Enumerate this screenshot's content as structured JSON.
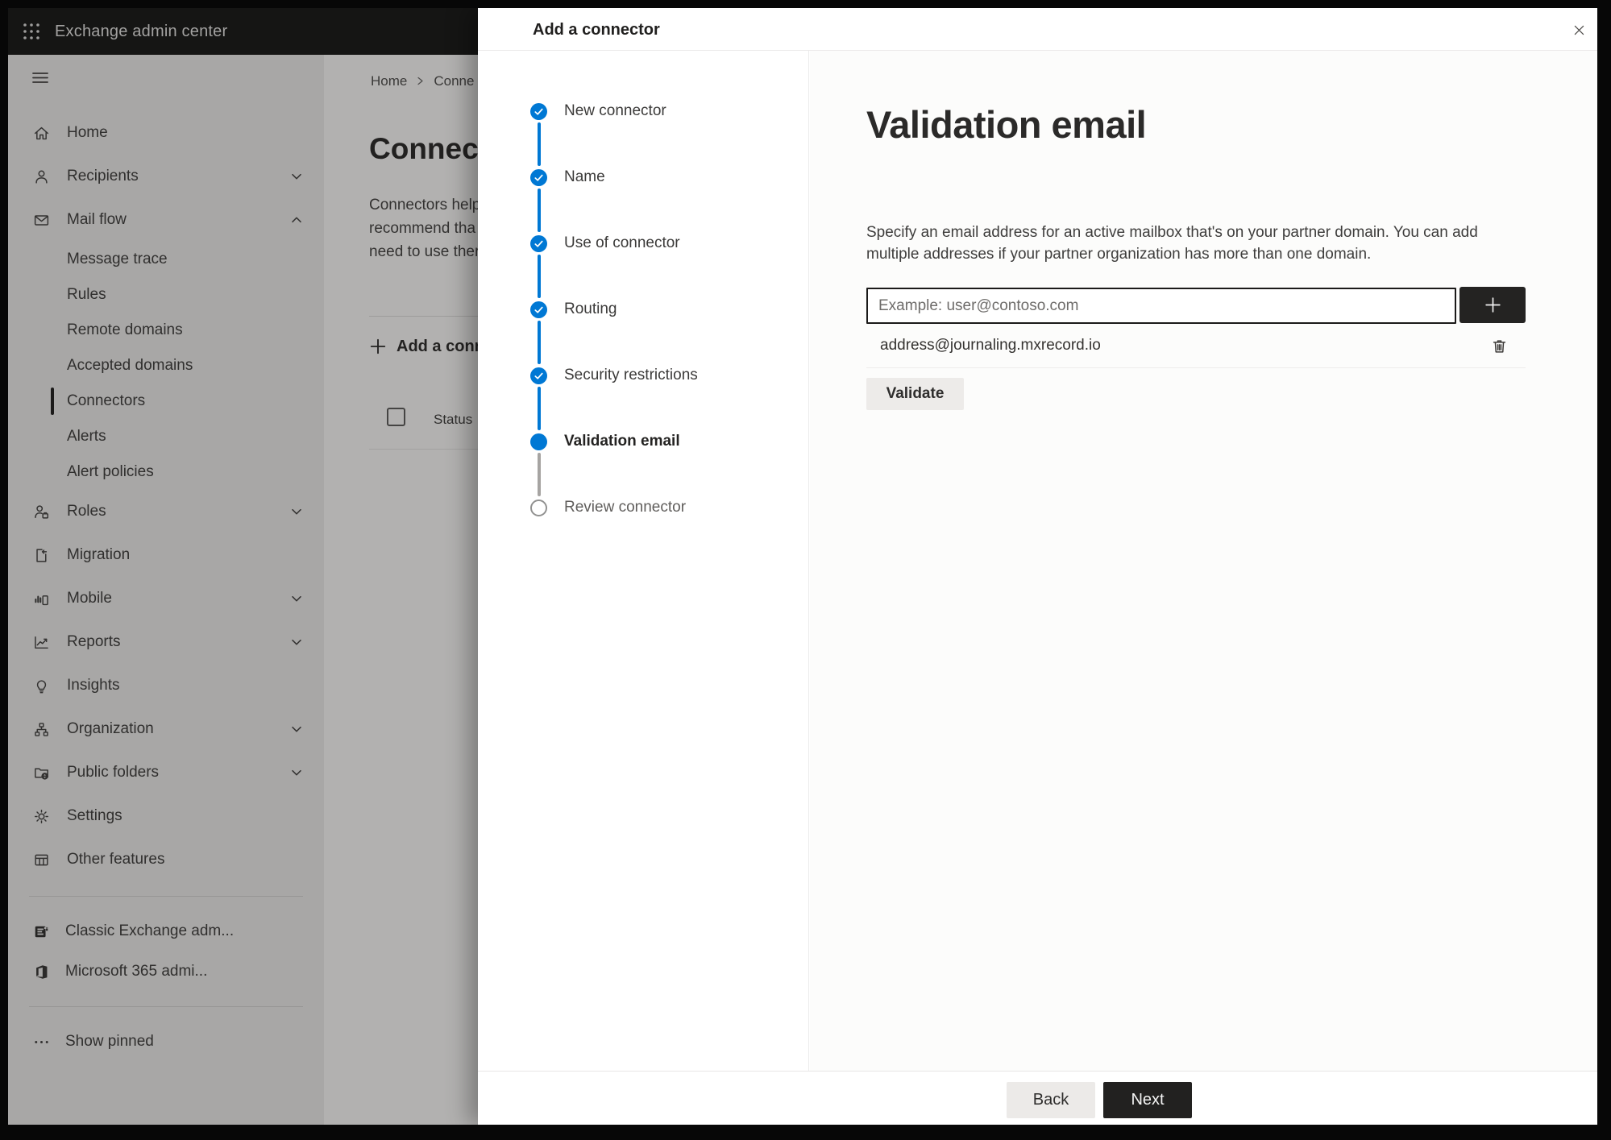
{
  "topbar": {
    "app_title": "Exchange admin center"
  },
  "sidebar": {
    "items": [
      {
        "label": "Home"
      },
      {
        "label": "Recipients"
      },
      {
        "label": "Mail flow"
      },
      {
        "label": "Message trace"
      },
      {
        "label": "Rules"
      },
      {
        "label": "Remote domains"
      },
      {
        "label": "Accepted domains"
      },
      {
        "label": "Connectors"
      },
      {
        "label": "Alerts"
      },
      {
        "label": "Alert policies"
      },
      {
        "label": "Roles"
      },
      {
        "label": "Migration"
      },
      {
        "label": "Mobile"
      },
      {
        "label": "Reports"
      },
      {
        "label": "Insights"
      },
      {
        "label": "Organization"
      },
      {
        "label": "Public folders"
      },
      {
        "label": "Settings"
      },
      {
        "label": "Other features"
      }
    ],
    "footer_links": [
      {
        "label": "Classic Exchange adm..."
      },
      {
        "label": "Microsoft 365 admi..."
      }
    ],
    "show_pinned_label": "Show pinned"
  },
  "background_page": {
    "breadcrumb": {
      "home": "Home",
      "current": "Conne"
    },
    "heading": "Connec",
    "intro_lines": [
      "Connectors help",
      "recommend tha",
      "need to use ther"
    ],
    "add_connector_label": "Add a conn",
    "status_header": "Status"
  },
  "wizard": {
    "title": "Add a connector",
    "steps": [
      {
        "label": "New connector",
        "state": "complete"
      },
      {
        "label": "Name",
        "state": "complete"
      },
      {
        "label": "Use of connector",
        "state": "complete"
      },
      {
        "label": "Routing",
        "state": "complete"
      },
      {
        "label": "Security restrictions",
        "state": "complete"
      },
      {
        "label": "Validation email",
        "state": "current"
      },
      {
        "label": "Review connector",
        "state": "upcoming"
      }
    ],
    "panel": {
      "heading": "Validation email",
      "description": "Specify an email address for an active mailbox that's on your partner domain. You can add multiple addresses if your partner organization has more than one domain.",
      "email_input_placeholder": "Example: user@contoso.com",
      "added_addresses": [
        "address@journaling.mxrecord.io"
      ],
      "validate_button_label": "Validate"
    },
    "footer": {
      "back_label": "Back",
      "next_label": "Next"
    }
  },
  "colors": {
    "accent_blue": "#0078d4",
    "next_button_bg": "#222120"
  }
}
